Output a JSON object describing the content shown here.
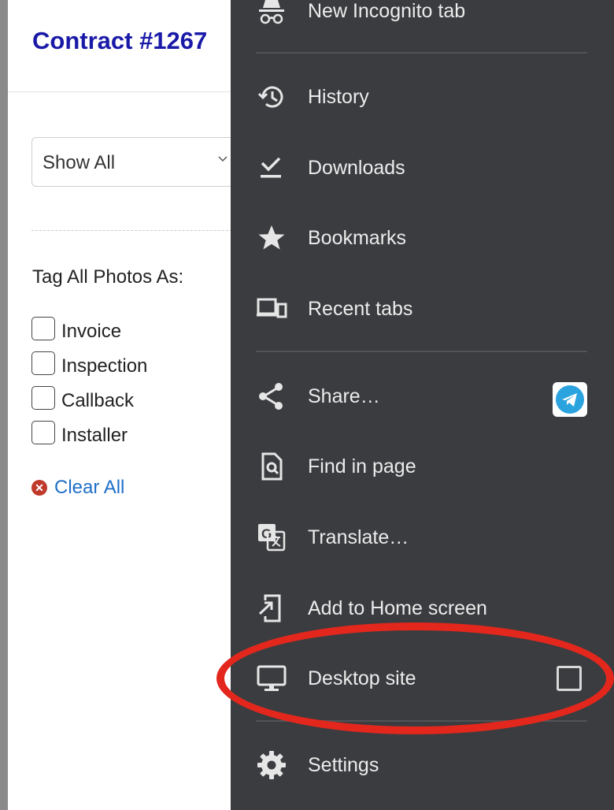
{
  "page": {
    "contract_title": "Contract #1267",
    "filter": {
      "selected": "Show All"
    },
    "tag_label": "Tag All Photos As:",
    "tags": [
      "Invoice",
      "Inspection",
      "Callback",
      "Installer"
    ],
    "clear_all": "Clear All"
  },
  "menu": {
    "items": [
      {
        "label": "New Incognito tab",
        "icon": "incognito-icon"
      },
      {
        "label": "History",
        "icon": "history-icon"
      },
      {
        "label": "Downloads",
        "icon": "download-icon"
      },
      {
        "label": "Bookmarks",
        "icon": "star-icon"
      },
      {
        "label": "Recent tabs",
        "icon": "devices-icon"
      },
      {
        "label": "Share…",
        "icon": "share-icon"
      },
      {
        "label": "Find in page",
        "icon": "find-in-page-icon"
      },
      {
        "label": "Translate…",
        "icon": "translate-icon"
      },
      {
        "label": "Add to Home screen",
        "icon": "add-to-home-icon"
      },
      {
        "label": "Desktop site",
        "icon": "desktop-icon",
        "checked": false
      },
      {
        "label": "Settings",
        "icon": "gear-icon"
      }
    ]
  },
  "colors": {
    "menu_bg": "#3b3c3f",
    "title_blue": "#1a1aa8",
    "link_blue": "#1f6fc8",
    "annotation_red": "#e3271d",
    "telegram_blue": "#2aa3df"
  }
}
